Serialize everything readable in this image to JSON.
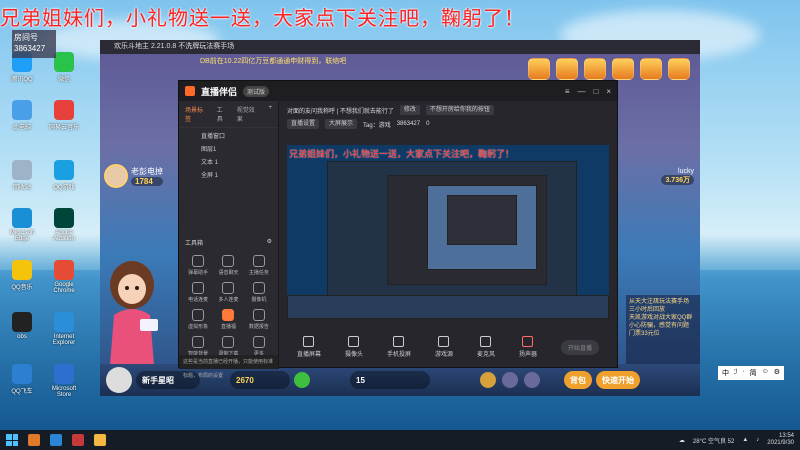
{
  "overlay": {
    "banner": "兄弟姐妹们，小礼物送一送，大家点下关注吧，鞠躬了！",
    "id_label": "房间号",
    "id_value": "3863427"
  },
  "desktop": {
    "icons": [
      {
        "label": "腾讯QQ",
        "color": "#1e9ef7"
      },
      {
        "label": "微信",
        "color": "#2bc24b"
      },
      {
        "label": "此电脑",
        "color": "#4aa0e8"
      },
      {
        "label": "网易云音乐",
        "color": "#e8403a"
      },
      {
        "label": "回收站",
        "color": "#9fb3c8"
      },
      {
        "label": "QQ游戏",
        "color": "#1aa0e0"
      },
      {
        "label": "Microsoft Edge",
        "color": "#1b8fd6"
      },
      {
        "label": "Adobe Audition",
        "color": "#00453a"
      },
      {
        "label": "QQ音乐",
        "color": "#f4c40c"
      },
      {
        "label": "Google Chrome",
        "color": "#e54b35"
      },
      {
        "label": "obs",
        "color": "#222222"
      },
      {
        "label": "Internet Explorer",
        "color": "#2a8fd8"
      },
      {
        "label": "QQ飞车",
        "color": "#2c7fd1"
      },
      {
        "label": "Microsoft Store",
        "color": "#2d6fcf"
      }
    ]
  },
  "game": {
    "title": "欢乐斗地主 2.21.0.8 不洗牌玩法赛手场",
    "notice": "DB前在10.22四亿万豆都通通申财得到，联络吧",
    "left_player": {
      "name": "老彭电掉",
      "coins": "1784"
    },
    "right_player": {
      "name": "lucky",
      "coins": "3.736万"
    },
    "bottom": {
      "player": "新手星昭",
      "beans": "2670",
      "tickets": "15",
      "btn_a": "背包",
      "btn_b": "快速开始"
    },
    "chat_lines": [
      "从天大注疏玩法赛手场",
      "三小时后回放",
      "天凯游戏对战大家QQ群",
      "小心防骗，感觉有问题",
      "门票33元位"
    ]
  },
  "stream": {
    "brand": "直播伴侣",
    "version": "测试版",
    "tabs": [
      "场景标签",
      "工具",
      "视觉效果"
    ],
    "scenes": [
      "直播窗口",
      "图层1",
      "文本 1",
      "全屏 1"
    ],
    "tools_title": "工具箱",
    "tools": [
      {
        "label": "弹幕助手",
        "hot": false
      },
      {
        "label": "语音聊天",
        "hot": false
      },
      {
        "label": "主播任务",
        "hot": false
      },
      {
        "label": "电话连麦",
        "hot": false
      },
      {
        "label": "多人连麦",
        "hot": false
      },
      {
        "label": "摄像机",
        "hot": false
      },
      {
        "label": "虚拟形象",
        "hot": false
      },
      {
        "label": "直播福",
        "hot": true
      },
      {
        "label": "数据报告",
        "hot": false
      },
      {
        "label": "智能背景",
        "hot": false
      },
      {
        "label": "录制下载",
        "hot": false
      },
      {
        "label": "更多",
        "hot": false
      }
    ],
    "left_footer": "这些是当前直播已经开播，只能使用标准标题，布局的设置",
    "toolbar_title": "对面的友问我称呼 | 不想我们就去能行了",
    "toolbar_tags": [
      "修改",
      "不想开房给你我的按钮"
    ],
    "meta": {
      "chip_a": "直播设置",
      "chip_b": "大屏展示",
      "tag_label": "Tag：游戏",
      "room": "3863427",
      "count": "0"
    },
    "bottom_tools": [
      "直播屏幕",
      "摄像头",
      "手机投屏",
      "游戏源",
      "麦克风",
      "扬声器"
    ],
    "start_label": "开始直播"
  },
  "taskbar": {
    "weather": "28°C 空气良 52",
    "time": "13:54",
    "date": "2021/9/30",
    "ime": [
      "中",
      "ℐ",
      "·",
      "简",
      "☺",
      "⚙"
    ]
  }
}
